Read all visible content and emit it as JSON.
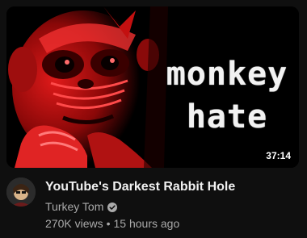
{
  "video": {
    "thumbnail_text": "monkey\nhate",
    "duration": "37:14",
    "title": "YouTube's Darkest Rabbit Hole",
    "channel": "Turkey Tom",
    "verified_icon": "verified-check-icon",
    "views": "270K views",
    "separator": "•",
    "age": "15 hours ago"
  },
  "colors": {
    "background": "#0f0f0f",
    "thumbnail_red": "#d41414",
    "title_text": "#f1f1f1",
    "secondary_text": "#aaaaaa"
  }
}
